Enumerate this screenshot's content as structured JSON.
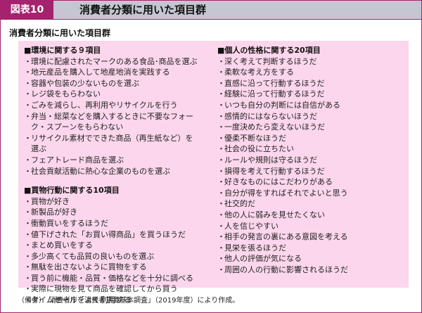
{
  "header": {
    "figure_label": "図表10",
    "title": "消費者分類に用いた項目群"
  },
  "subtitle": "消費者分類に用いた項目群",
  "left_column": {
    "section1": {
      "title": "■環境に関する９項目",
      "items": [
        "環境に配慮されたマークのある食品･商品を選ぶ",
        "地元産品を購入して地産地消を実践する",
        "容器や包装の少ないものを選ぶ",
        "レジ袋をもらわない",
        "ごみを減らし、再利用やリサイクルを行う",
        "弁当・総菜などを購入するときに不要なフォー|ク・スプーンをもらわない",
        "リサイクル素材でできた商品（再生紙など）を|選ぶ",
        "フェアトレード商品を選ぶ",
        "社会貢献活動に熱心な企業のものを選ぶ"
      ]
    },
    "section2": {
      "title": "■買物行動に関する10項目",
      "items": [
        "買物が好き",
        "新製品が好き",
        "衝動買いをするほうだ",
        "値下げされた「お買い得商品」を買うほうだ",
        "まとめ買いをする",
        "多少高くても品質の良いものを選ぶ",
        "無駄を出さないように買物をする",
        "買う前に機能・品質・価格などを十分に調べる",
        "実際に現物を見て商品を確認してから買う",
        "タイムセールをよく利用する"
      ]
    }
  },
  "right_column": {
    "section3": {
      "title": "■個人の性格に関する20項目",
      "items": [
        "深く考えて判断するほうだ",
        "柔軟な考え方をする",
        "直感に沿って行動するほうだ",
        "経験に沿って行動するほうだ",
        "いつも自分の判断には自信がある",
        "感情的にはならないほうだ",
        "一度決めたら変えないほうだ",
        "優柔不断なほうだ",
        "社会の役に立ちたい",
        "ルールや規則は守るほうだ",
        "損得を考えて行動するほうだ",
        "好きなものにはこだわりがある",
        "自分が得をすればそれでよいと思う",
        "社交的だ",
        "他の人に弱みを見せたくない",
        "人を信じやすい",
        "相手の発言の裏にある意図を考える",
        "見栄を張るほうだ",
        "他人の評価が気になる",
        "周囲の人の行動に影響されるほうだ"
      ]
    }
  },
  "bullet": "・",
  "note": "（備考）　消費者庁「消費者意識基本調査」（2019年度）により作成。",
  "colors": {
    "accent": "#a4226e",
    "header_bg": "#c8c5d2",
    "panel_bg": "#fbd6ec"
  }
}
